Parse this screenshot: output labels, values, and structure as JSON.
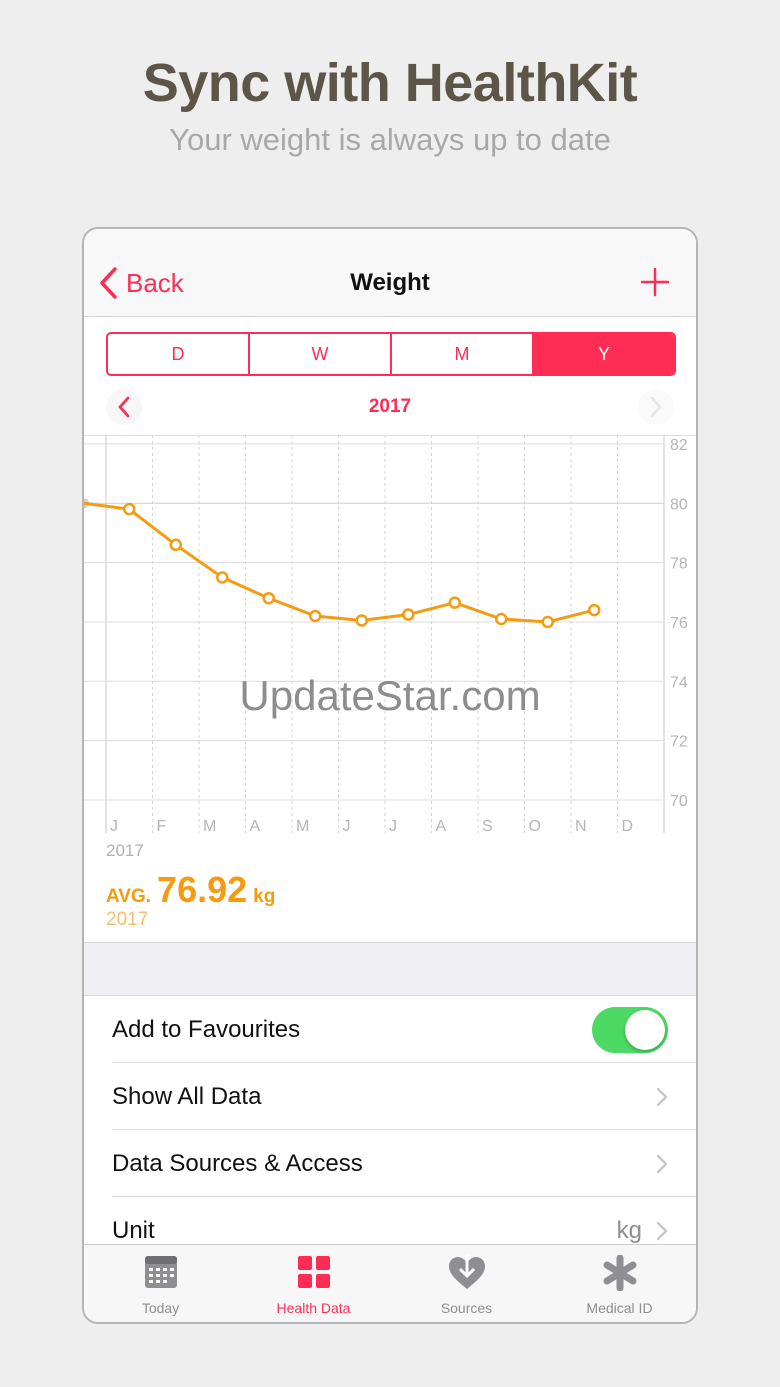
{
  "marketing": {
    "title": "Sync with HealthKit",
    "subtitle": "Your weight is always up to date"
  },
  "navbar": {
    "back_label": "Back",
    "title": "Weight"
  },
  "segments": [
    {
      "label": "D",
      "active": false
    },
    {
      "label": "W",
      "active": false
    },
    {
      "label": "M",
      "active": false
    },
    {
      "label": "Y",
      "active": true
    }
  ],
  "period": {
    "label": "2017"
  },
  "chart_data": {
    "type": "line",
    "x": [
      "J",
      "F",
      "M",
      "A",
      "M",
      "J",
      "J",
      "A",
      "S",
      "O",
      "N",
      "D"
    ],
    "series": [
      {
        "values": [
          79.8,
          78.6,
          77.5,
          76.8,
          76.2,
          76.05,
          76.25,
          76.65,
          76.1,
          76.0,
          76.4,
          null
        ]
      }
    ],
    "yticks": [
      82,
      80,
      78,
      76,
      74,
      72,
      70
    ],
    "ylim": [
      70,
      82
    ],
    "reference_line": 80,
    "grid": true,
    "year_label": "2017",
    "line_color": "#f39c12"
  },
  "summary": {
    "avg_label": "AVG.",
    "avg_value": "76.92",
    "unit": "kg",
    "year": "2017"
  },
  "list": {
    "favourites_label": "Add to Favourites",
    "favourites_on": true,
    "show_all_label": "Show All Data",
    "sources_label": "Data Sources & Access",
    "unit_label": "Unit",
    "unit_value": "kg"
  },
  "tabs": [
    {
      "label": "Today",
      "icon": "calendar-icon",
      "active": false
    },
    {
      "label": "Health Data",
      "icon": "grid-icon",
      "active": true
    },
    {
      "label": "Sources",
      "icon": "heart-download-icon",
      "active": false
    },
    {
      "label": "Medical ID",
      "icon": "asterisk-icon",
      "active": false
    }
  ],
  "watermark": "UpdateStar.com",
  "colors": {
    "accent": "#ff2d55",
    "chart_line": "#f39c12",
    "toggle_on": "#4cd964",
    "headline": "#5d5547"
  }
}
